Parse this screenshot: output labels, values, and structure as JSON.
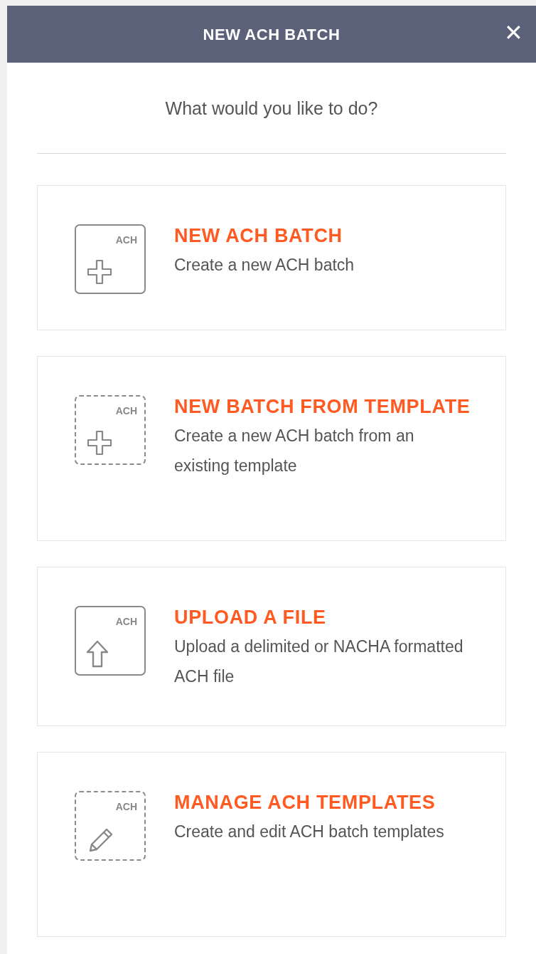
{
  "dialog": {
    "title": "NEW ACH BATCH",
    "close": "✕"
  },
  "prompt": "What would you like to do?",
  "options": [
    {
      "title": "NEW ACH BATCH",
      "description": "Create a new ACH batch",
      "icon_label": "ACH",
      "kind": "create",
      "dashed": false
    },
    {
      "title": "NEW BATCH FROM TEMPLATE",
      "description": "Create a new ACH batch from an existing template",
      "icon_label": "ACH",
      "kind": "create",
      "dashed": true
    },
    {
      "title": "UPLOAD A FILE",
      "description": "Upload a delimited or NACHA formatted ACH file",
      "icon_label": "ACH",
      "kind": "upload",
      "dashed": false
    },
    {
      "title": "MANAGE ACH TEMPLATES",
      "description": "Create and edit ACH batch templates",
      "icon_label": "ACH",
      "kind": "edit",
      "dashed": true
    }
  ]
}
